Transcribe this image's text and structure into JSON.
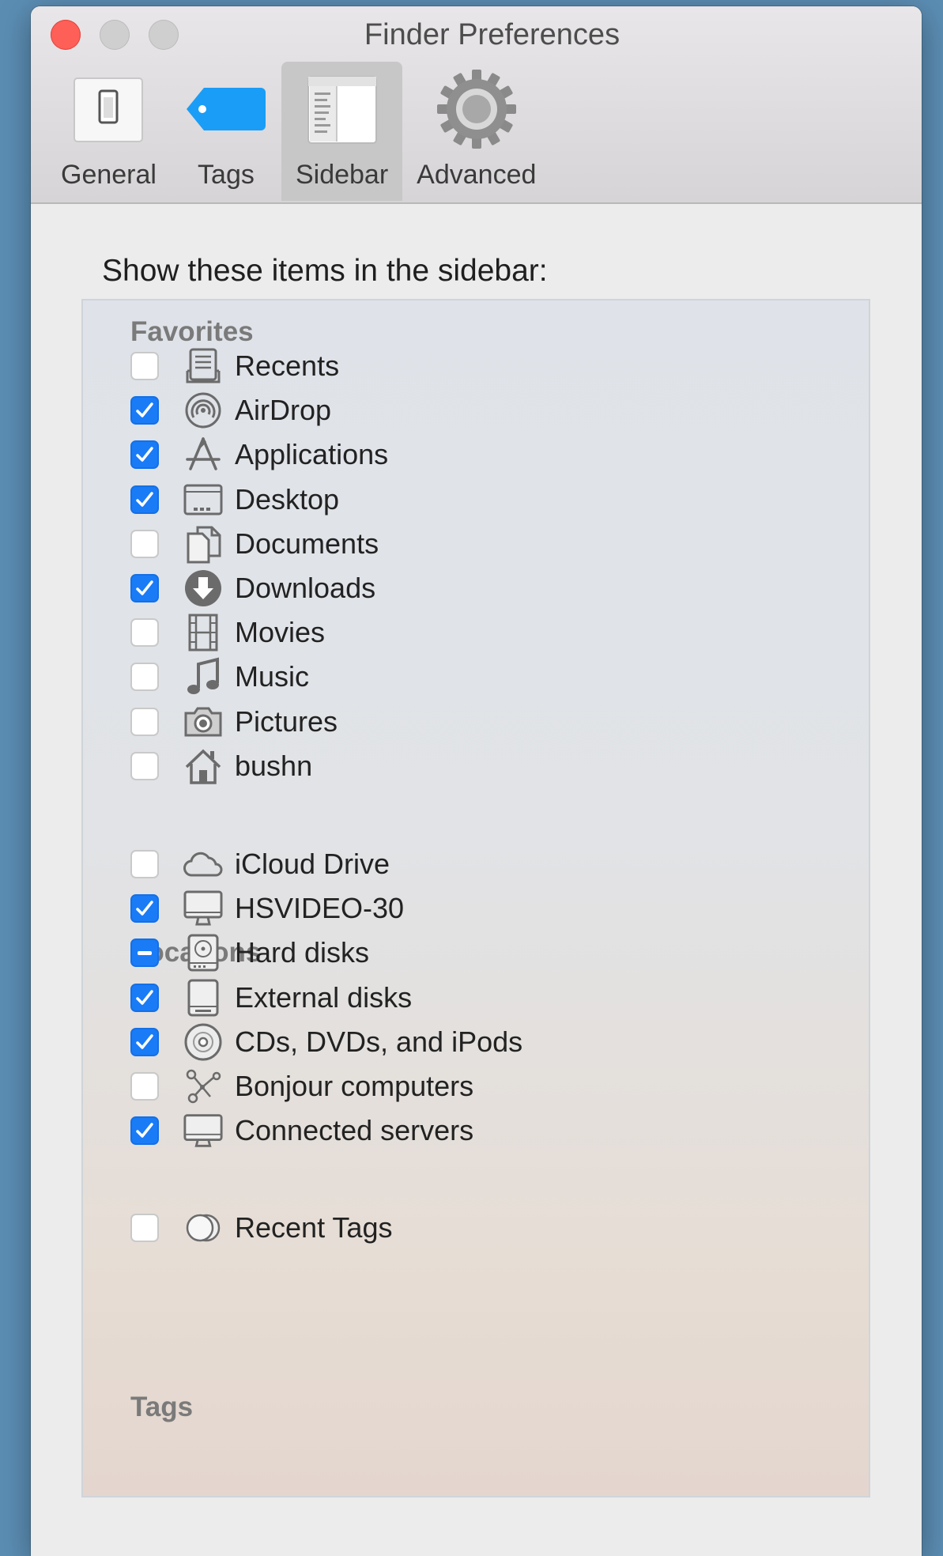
{
  "window": {
    "title": "Finder Preferences"
  },
  "toolbar": [
    {
      "label": "General",
      "icon": "switch-icon",
      "selected": false
    },
    {
      "label": "Tags",
      "icon": "tag-icon",
      "selected": false
    },
    {
      "label": "Sidebar",
      "icon": "sidebar-icon",
      "selected": true
    },
    {
      "label": "Advanced",
      "icon": "gear-icon",
      "selected": false
    }
  ],
  "heading": "Show these items in the sidebar:",
  "sections": {
    "favorites": {
      "title": "Favorites",
      "items": [
        {
          "label": "Recents",
          "state": "unchecked",
          "icon": "recents-icon"
        },
        {
          "label": "AirDrop",
          "state": "checked",
          "icon": "airdrop-icon"
        },
        {
          "label": "Applications",
          "state": "checked",
          "icon": "applications-icon"
        },
        {
          "label": "Desktop",
          "state": "checked",
          "icon": "desktop-icon"
        },
        {
          "label": "Documents",
          "state": "unchecked",
          "icon": "documents-icon"
        },
        {
          "label": "Downloads",
          "state": "checked",
          "icon": "downloads-icon"
        },
        {
          "label": "Movies",
          "state": "unchecked",
          "icon": "movies-icon"
        },
        {
          "label": "Music",
          "state": "unchecked",
          "icon": "music-icon"
        },
        {
          "label": "Pictures",
          "state": "unchecked",
          "icon": "camera-icon"
        },
        {
          "label": "bushn",
          "state": "unchecked",
          "icon": "home-icon"
        }
      ]
    },
    "locations": {
      "title": "Locations",
      "items": [
        {
          "label": "iCloud Drive",
          "state": "unchecked",
          "icon": "cloud-icon"
        },
        {
          "label": "HSVIDEO-30",
          "state": "checked",
          "icon": "imac-icon"
        },
        {
          "label": "Hard disks",
          "state": "mixed",
          "icon": "hard-disk-icon"
        },
        {
          "label": "External disks",
          "state": "checked",
          "icon": "external-disk-icon"
        },
        {
          "label": "CDs, DVDs, and iPods",
          "state": "checked",
          "icon": "disc-icon"
        },
        {
          "label": "Bonjour computers",
          "state": "unchecked",
          "icon": "bonjour-icon"
        },
        {
          "label": "Connected servers",
          "state": "checked",
          "icon": "server-icon"
        }
      ]
    },
    "tags": {
      "title": "Tags",
      "items": [
        {
          "label": "Recent Tags",
          "state": "unchecked",
          "icon": "recent-tags-icon"
        }
      ]
    }
  },
  "colors": {
    "accent": "#1a7bf7",
    "close": "#fe5f57",
    "desktop": "#5b8db3"
  }
}
